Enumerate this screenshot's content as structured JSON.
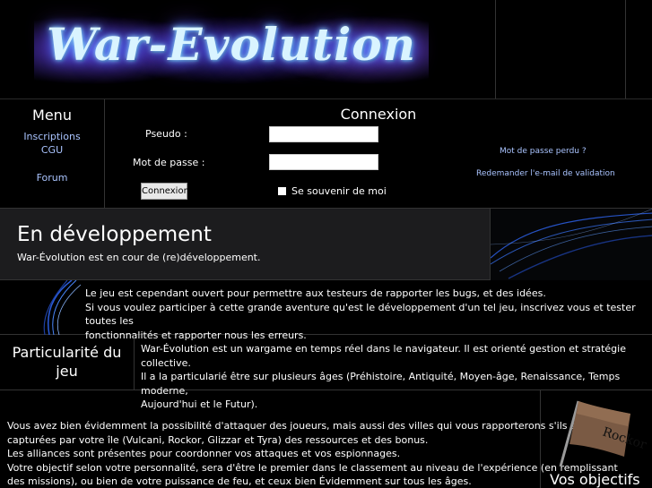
{
  "banner": {
    "logo_text": "War-Evolution"
  },
  "menu": {
    "title": "Menu",
    "links": [
      "Inscriptions",
      "CGU",
      "Forum"
    ]
  },
  "login": {
    "title": "Connexion",
    "pseudo_label": "Pseudo :",
    "password_label": "Mot de passe :",
    "submit_label": "Connexion",
    "remember_label": "Se souvenir de moi",
    "remember_checked": false,
    "forgot_link": "Mot de passe perdu ?",
    "resend_link": "Redemander l'e-mail de validation"
  },
  "dev": {
    "title": "En développement",
    "subtitle": "War-Évolution est en cour de (re)développement."
  },
  "intro": {
    "lines": [
      "Le jeu est cependant ouvert pour permettre aux testeurs de rapporter les bugs, et des idées.",
      "Si vous voulez participer à cette grande aventure qu'est le développement d'un tel jeu, inscrivez vous et tester toutes les",
      "fonctionnalités et rapporter nous les erreurs."
    ]
  },
  "particularite": {
    "title_line1": "Particularité du",
    "title_line2": "jeu",
    "lines": [
      "War-Évolution est un wargame en temps réel dans le navigateur. Il est orienté gestion et stratégie collective.",
      "Il a la particularié être sur plusieurs âges (Préhistoire, Antiquité, Moyen-âge, Renaissance, Temps moderne,",
      "Aujourd'hui et le Futur)."
    ]
  },
  "objectifs": {
    "title": "Vos objectifs",
    "flag_text": "Rockor",
    "lines": [
      "Vous avez bien évidemment la possibilité d'attaquer des joueurs, mais aussi des villes qui vous rapporterons s'ils sont",
      "capturées par votre île (Vulcani, Rockor, Glizzar et Tyra) des ressources et des bonus.",
      "Les alliances sont présentes pour coordonner vos attaques et vos espionnages.",
      "Votre objectif selon votre personnalité, sera d'être le premier dans le classement au niveau de l'expérience (en remplissant",
      "des missions), ou bien de votre puissance de feu, et ceux bien Évidemment sur tous les âges."
    ]
  },
  "colors": {
    "link": "#aac4ff",
    "background": "#000000",
    "panel": "#1c1c1e",
    "glow": "#3a8cff"
  }
}
